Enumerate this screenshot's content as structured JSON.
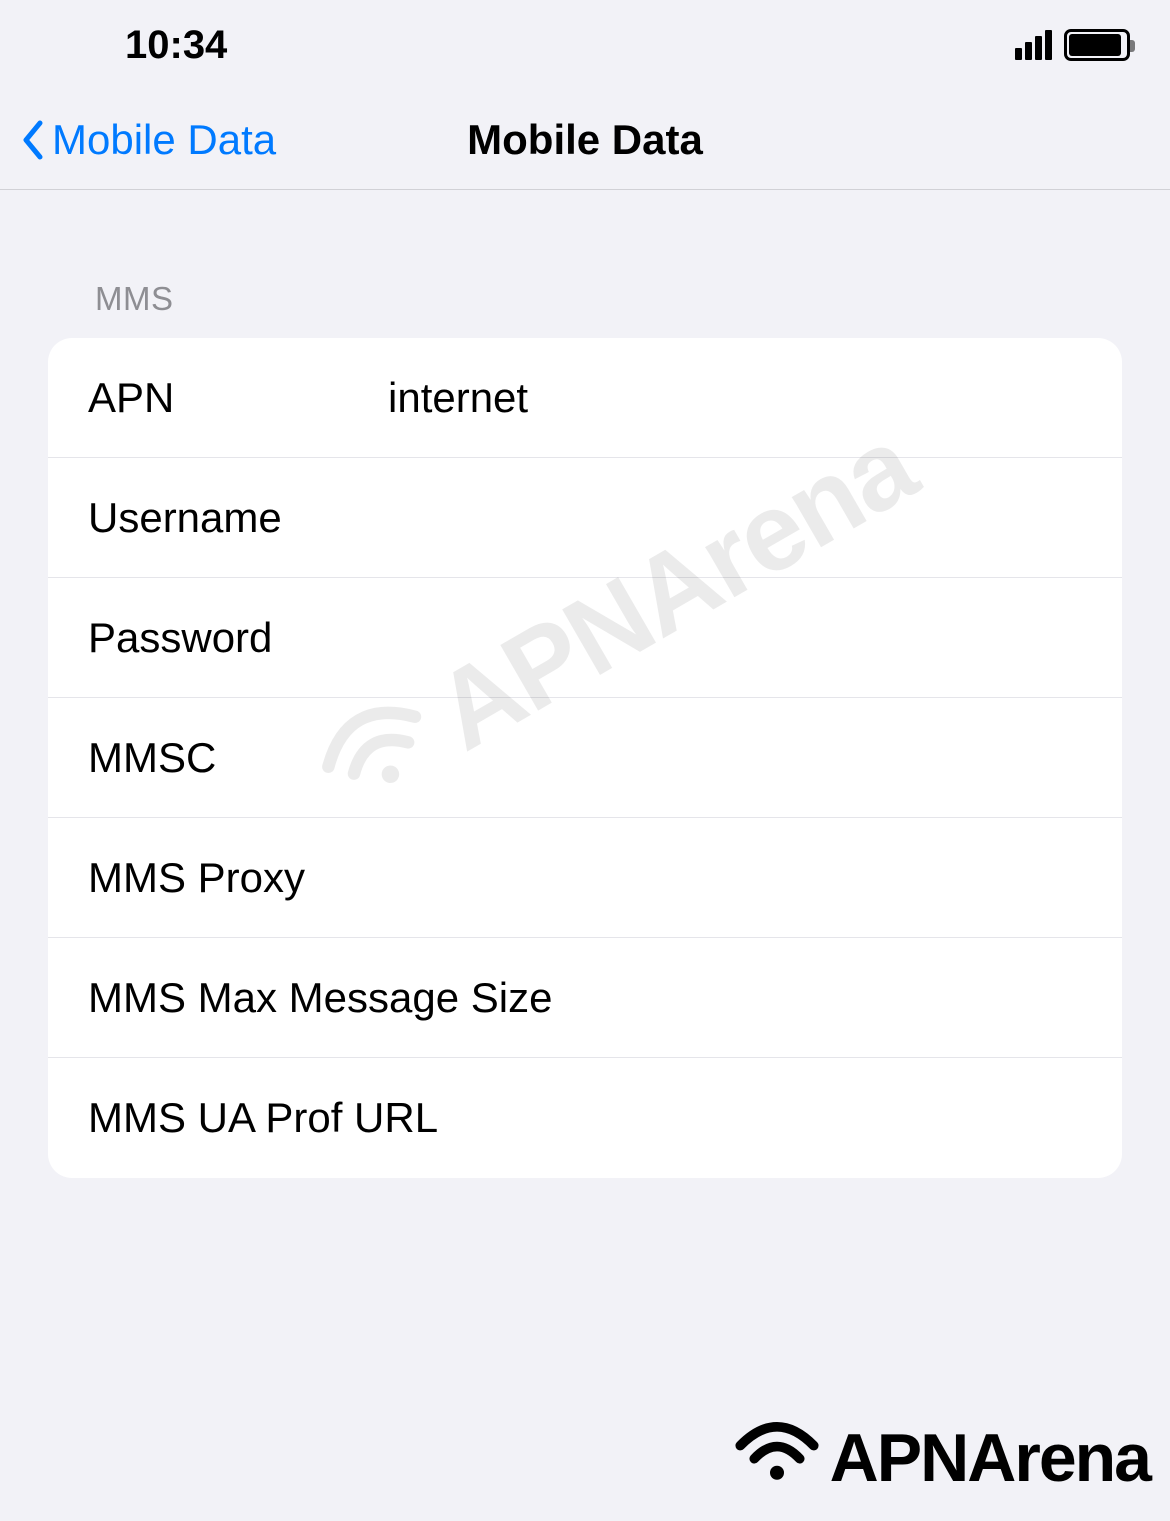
{
  "status_bar": {
    "time": "10:34"
  },
  "nav": {
    "back_label": "Mobile Data",
    "title": "Mobile Data"
  },
  "section": {
    "header": "MMS",
    "rows": [
      {
        "label": "APN",
        "value": "internet"
      },
      {
        "label": "Username",
        "value": ""
      },
      {
        "label": "Password",
        "value": ""
      },
      {
        "label": "MMSC",
        "value": ""
      },
      {
        "label": "MMS Proxy",
        "value": ""
      },
      {
        "label": "MMS Max Message Size",
        "value": ""
      },
      {
        "label": "MMS UA Prof URL",
        "value": ""
      }
    ]
  },
  "watermark": {
    "text": "APNArena"
  },
  "footer": {
    "text": "APNArena"
  }
}
